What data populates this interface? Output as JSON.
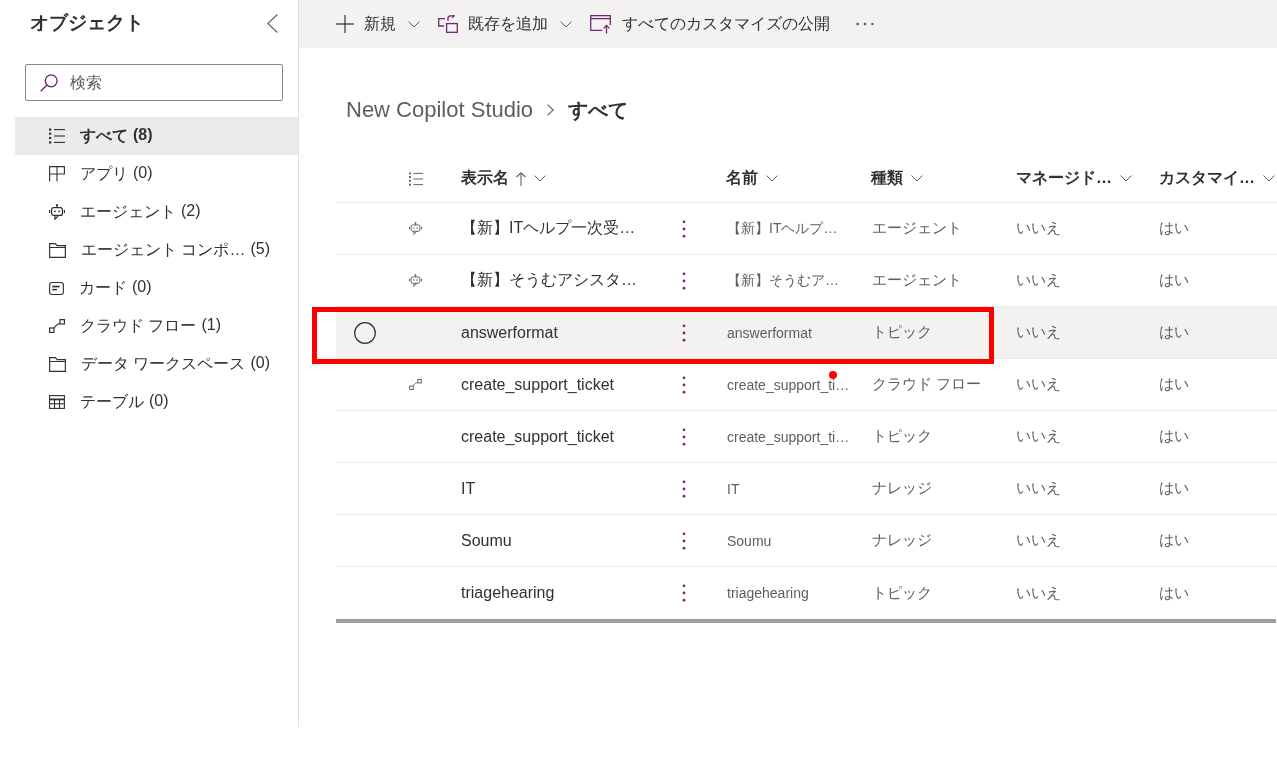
{
  "sidebar": {
    "title": "オブジェクト",
    "search": {
      "placeholder": "検索"
    },
    "items": [
      {
        "kind": "all",
        "label": "すべて",
        "count": "(8)",
        "selected": true
      },
      {
        "kind": "app",
        "label": "アプリ",
        "count": "(0)",
        "selected": false
      },
      {
        "kind": "agent",
        "label": "エージェント",
        "count": "(2)",
        "selected": false
      },
      {
        "kind": "component",
        "label": "エージェント コンポ…",
        "count": "(5)",
        "selected": false
      },
      {
        "kind": "card",
        "label": "カード",
        "count": "(0)",
        "selected": false
      },
      {
        "kind": "flow",
        "label": "クラウド フロー",
        "count": "(1)",
        "selected": false
      },
      {
        "kind": "workspace",
        "label": "データ ワークスペース",
        "count": "(0)",
        "selected": false
      },
      {
        "kind": "table",
        "label": "テーブル",
        "count": "(0)",
        "selected": false
      }
    ]
  },
  "toolbar": {
    "items": [
      {
        "kind": "new",
        "label": "新規",
        "dropdown": true
      },
      {
        "kind": "add_existing",
        "label": "既存を追加",
        "dropdown": true
      },
      {
        "kind": "publish",
        "label": "すべてのカスタマイズの公開",
        "dropdown": false
      }
    ]
  },
  "breadcrumb": [
    {
      "label": "New Copilot Studio",
      "current": false
    },
    {
      "label": "すべて",
      "current": true
    }
  ],
  "table": {
    "columns": [
      {
        "label": "表示名",
        "sorted": true
      },
      {
        "label": "名前",
        "sorted": false
      },
      {
        "label": "種類",
        "sorted": false
      },
      {
        "label": "マネージド…",
        "sorted": false
      },
      {
        "label": "カスタマイ…",
        "sorted": false
      }
    ],
    "rows": [
      {
        "kind": "agent",
        "display_name": "【新】ITヘルプ一次受…",
        "name": "【新】ITヘルプ…",
        "type": "エージェント",
        "managed": "いいえ",
        "customizable": "はい",
        "hovered": false,
        "annotated": false,
        "marked": false
      },
      {
        "kind": "agent",
        "display_name": "【新】そうむアシスタ…",
        "name": "【新】そうむア…",
        "type": "エージェント",
        "managed": "いいえ",
        "customizable": "はい",
        "hovered": false,
        "annotated": false,
        "marked": false
      },
      {
        "kind": "topic",
        "display_name": "answerformat",
        "name": "answerformat",
        "type": "トピック",
        "managed": "いいえ",
        "customizable": "はい",
        "hovered": true,
        "annotated": true,
        "marked": false
      },
      {
        "kind": "flow",
        "display_name": "create_support_ticket",
        "name": "create_support_ti…",
        "type": "クラウド フロー",
        "managed": "いいえ",
        "customizable": "はい",
        "hovered": false,
        "annotated": false,
        "marked": true
      },
      {
        "kind": "topic",
        "display_name": "create_support_ticket",
        "name": "create_support_ti…",
        "type": "トピック",
        "managed": "いいえ",
        "customizable": "はい",
        "hovered": false,
        "annotated": false,
        "marked": false
      },
      {
        "kind": "knowledge",
        "display_name": "IT",
        "name": "IT",
        "type": "ナレッジ",
        "managed": "いいえ",
        "customizable": "はい",
        "hovered": false,
        "annotated": false,
        "marked": false
      },
      {
        "kind": "knowledge",
        "display_name": "Soumu",
        "name": "Soumu",
        "type": "ナレッジ",
        "managed": "いいえ",
        "customizable": "はい",
        "hovered": false,
        "annotated": false,
        "marked": false
      },
      {
        "kind": "topic",
        "display_name": "triagehearing",
        "name": "triagehearing",
        "type": "トピック",
        "managed": "いいえ",
        "customizable": "はい",
        "hovered": false,
        "annotated": false,
        "marked": false
      }
    ]
  }
}
